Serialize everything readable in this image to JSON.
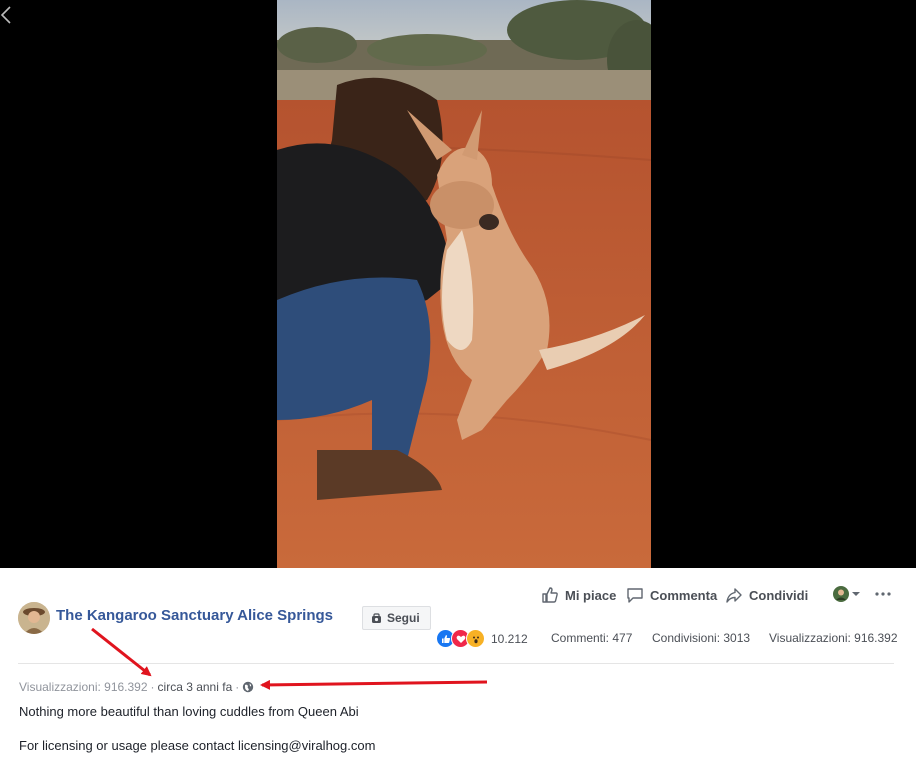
{
  "page": {
    "name": "The Kangaroo Sanctuary Alice Springs",
    "follow_label": "Segui"
  },
  "actions": {
    "like_label": "Mi piace",
    "comment_label": "Commenta",
    "share_label": "Condividi"
  },
  "stats": {
    "reactions_count": "10.212",
    "comments": "Commenti: 477",
    "shares": "Condivisioni: 3013",
    "views": "Visualizzazioni: 916.392"
  },
  "meta": {
    "views": "Visualizzazioni: 916.392",
    "separator": "·",
    "time": "circa 3 anni fa"
  },
  "post": {
    "description": "Nothing more beautiful than loving cuddles from Queen Abi",
    "licensing": "For licensing or usage please contact licensing@viralhog.com"
  },
  "icons": {
    "back": "chevron-left-icon",
    "like": "thumbs-up-icon",
    "comment": "speech-bubble-icon",
    "share": "share-arrow-icon",
    "privacy": "globe-icon",
    "more": "more-dots-icon"
  },
  "colors": {
    "link_blue": "#365899",
    "annotation_red": "#e0141e",
    "like_blue": "#1877f2",
    "love_red": "#f0284a",
    "wow_yellow": "#f7b125"
  }
}
